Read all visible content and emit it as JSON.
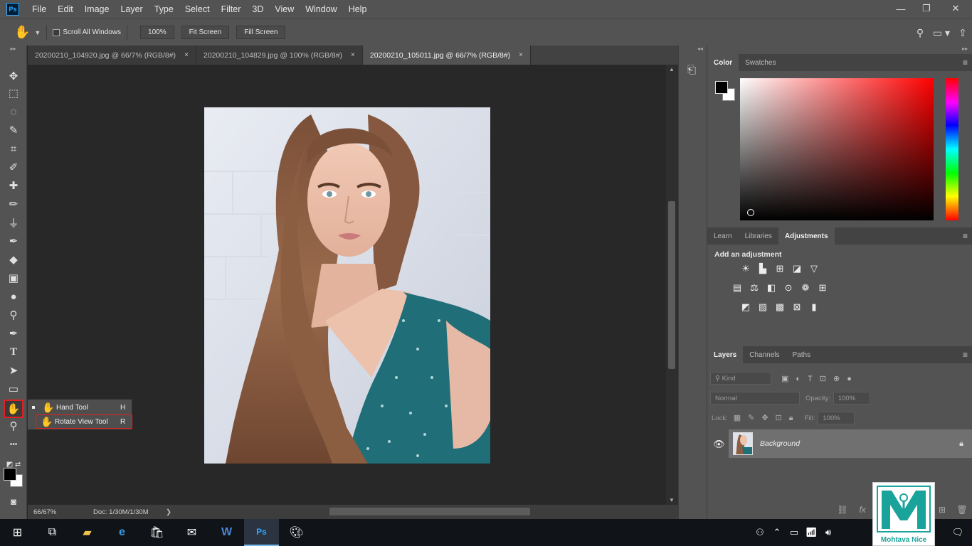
{
  "app": {
    "logo_text": "Ps"
  },
  "menu": [
    "File",
    "Edit",
    "Image",
    "Layer",
    "Type",
    "Select",
    "Filter",
    "3D",
    "View",
    "Window",
    "Help"
  ],
  "window_controls": [
    "minimize",
    "restore",
    "close"
  ],
  "options_bar": {
    "scroll_all_label": "Scroll All Windows",
    "zoom_100": "100%",
    "fit_screen": "Fit Screen",
    "fill_screen": "Fill Screen"
  },
  "tabs": [
    {
      "label": "20200210_104920.jpg @ 66/7% (RGB/8#)",
      "close": "×",
      "active": false
    },
    {
      "label": "20200210_104829.jpg @ 100% (RGB/8#)",
      "close": "×",
      "active": false
    },
    {
      "label": "20200210_105011.jpg @ 66/7% (RGB/8#)",
      "close": "×",
      "active": true
    }
  ],
  "tools": [
    {
      "name": "move-tool-icon",
      "glyph": "✥"
    },
    {
      "name": "marquee-tool-icon",
      "glyph": "⬚"
    },
    {
      "name": "lasso-tool-icon",
      "glyph": "◌"
    },
    {
      "name": "quick-select-tool-icon",
      "glyph": "✎"
    },
    {
      "name": "crop-tool-icon",
      "glyph": "⌗"
    },
    {
      "name": "eyedropper-tool-icon",
      "glyph": "✐"
    },
    {
      "name": "healing-brush-tool-icon",
      "glyph": "✚"
    },
    {
      "name": "brush-tool-icon",
      "glyph": "✏"
    },
    {
      "name": "clone-stamp-tool-icon",
      "glyph": "⏚"
    },
    {
      "name": "history-brush-tool-icon",
      "glyph": "✒"
    },
    {
      "name": "eraser-tool-icon",
      "glyph": "◆"
    },
    {
      "name": "gradient-tool-icon",
      "glyph": "▣"
    },
    {
      "name": "blur-tool-icon",
      "glyph": "●"
    },
    {
      "name": "dodge-tool-icon",
      "glyph": "⚲"
    },
    {
      "name": "pen-tool-icon",
      "glyph": "✒"
    },
    {
      "name": "type-tool-icon",
      "glyph": "T"
    },
    {
      "name": "path-selection-tool-icon",
      "glyph": "➤"
    },
    {
      "name": "rectangle-tool-icon",
      "glyph": "▭"
    },
    {
      "name": "hand-tool-icon",
      "glyph": "✋"
    },
    {
      "name": "zoom-tool-icon",
      "glyph": "⚲"
    },
    {
      "name": "more-tools-icon",
      "glyph": "•••"
    }
  ],
  "flyout": {
    "items": [
      {
        "label": "Hand Tool",
        "key": "H",
        "glyph": "✋"
      },
      {
        "label": "Rotate View Tool",
        "key": "R",
        "glyph": "✋"
      }
    ]
  },
  "status": {
    "zoom": "66/67%",
    "doc": "Doc: 1/30M/1/30M",
    "arrow": "❯"
  },
  "color_panel": {
    "tabs": [
      "Color",
      "Swatches"
    ]
  },
  "adjustments_panel": {
    "tabs": [
      "Learn",
      "Libraries",
      "Adjustments"
    ],
    "title": "Add an adjustment",
    "row1": [
      "brightness-contrast-icon",
      "levels-icon",
      "curves-icon",
      "exposure-icon",
      "vibrance-icon"
    ],
    "row2": [
      "hue-saturation-icon",
      "color-balance-icon",
      "black-white-icon",
      "photo-filter-icon",
      "channel-mixer-icon",
      "color-lookup-icon"
    ],
    "row3": [
      "invert-icon",
      "posterize-icon",
      "threshold-icon",
      "selective-color-icon",
      "gradient-map-icon"
    ]
  },
  "layers_panel": {
    "tabs": [
      "Layers",
      "Channels",
      "Paths"
    ],
    "kind": "Kind",
    "blend_mode": "Normal",
    "opacity_label": "Opacity:",
    "opacity_value": "100%",
    "lock_label": "Lock:",
    "fill_label": "Fill:",
    "fill_value": "100%",
    "layer_name": "Background"
  },
  "watermark": {
    "text": "Mohtava Nice"
  },
  "colors": {
    "ui_dark": "#535353",
    "canvas": "#282828",
    "highlight_red": "#e02020",
    "brand_teal": "#1aa39a"
  }
}
